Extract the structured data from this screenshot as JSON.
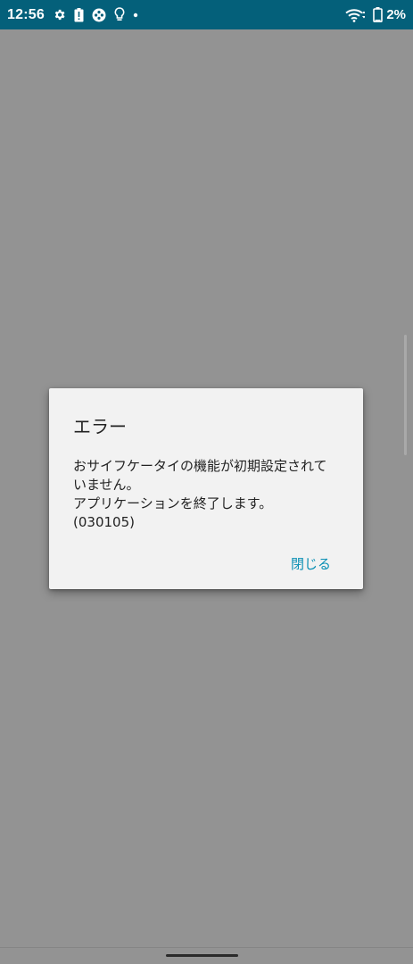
{
  "status_bar": {
    "time": "12:56",
    "battery_percent": "2%",
    "background_color": "#04607a",
    "icons_left": [
      "settings-gear-icon",
      "battery-alert-icon",
      "game-controller-icon",
      "lightbulb-icon",
      "notification-dot-icon"
    ],
    "icons_right": [
      "wifi-icon",
      "battery-icon"
    ]
  },
  "dialog": {
    "title": "エラー",
    "message_lines": [
      "おサイフケータイの機能が初期設定されて",
      "いません。",
      "アプリケーションを終了します。",
      "(030105)"
    ],
    "close_label": "閉じる",
    "accent_color": "#0a8fb4"
  }
}
